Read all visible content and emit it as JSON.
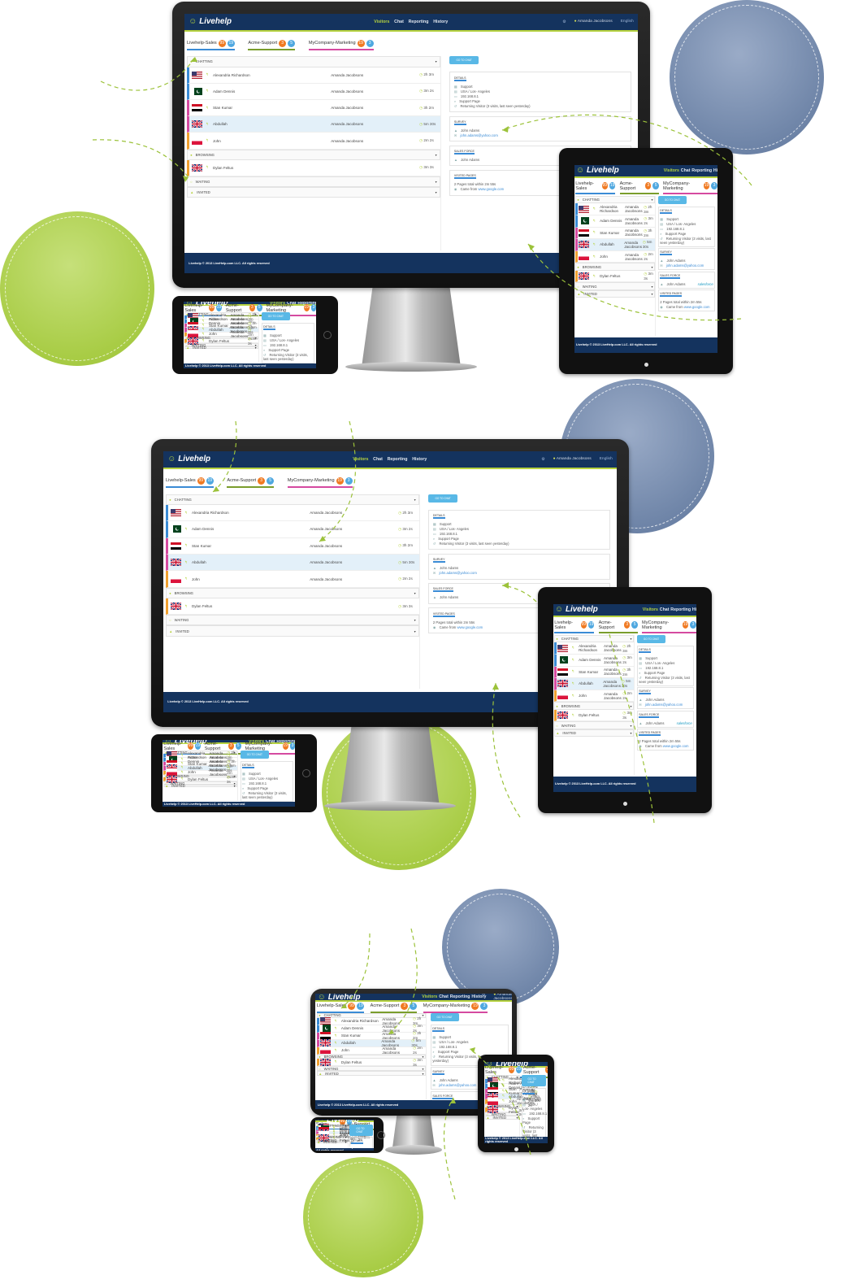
{
  "app": {
    "logo": "Livehelp",
    "nav": [
      "Visitors",
      "Chat",
      "Reporting",
      "History"
    ],
    "user": "Amanda Jacobsons",
    "language": "English",
    "footer": "Livehelp © 2013 LiveHelp.com LLC.  All rights reserved"
  },
  "tabs": [
    {
      "label": "Livehelp-Sales",
      "count_a": "99",
      "count_b": "19"
    },
    {
      "label": "Acme-Support",
      "count_a": "3",
      "count_b": "5"
    },
    {
      "label": "MyCompany-Marketing",
      "count_a": "19",
      "count_b": "3"
    }
  ],
  "sections": {
    "chatting": "CHATTING",
    "browsing": "BROWSING",
    "waiting": "WAITING",
    "invited": "INVITED"
  },
  "visitors": [
    {
      "name": "Alexandria Richardson",
      "agent": "Amanda Jacobsons",
      "time": "2h 3m",
      "flag": "us",
      "bar": "#3a8bd5"
    },
    {
      "name": "Adam Dennis",
      "agent": "Amanda Jacobsons",
      "time": "3m 2s",
      "flag": "pk",
      "bar": "#3a8bd5"
    },
    {
      "name": "Stan Kumar",
      "agent": "Amanda Jacobsons",
      "time": "3h 2m",
      "flag": "eg",
      "bar": "#d54aa0"
    },
    {
      "name": "Abdullah",
      "agent": "Amanda Jacobsons",
      "time": "5m 30s",
      "flag": "uk",
      "bar": "#d54aa0"
    },
    {
      "name": "John",
      "agent": "Amanda Jacobsons",
      "time": "2m 2s",
      "flag": "pl",
      "bar": "#f0a030"
    }
  ],
  "browsing": [
    {
      "name": "Dylan Feltus",
      "time": "3m 3s",
      "flag": "uk",
      "bar": "#f0a030"
    }
  ],
  "details": {
    "goto_chat": "GO TO CHAT",
    "details_title": "DETAILS",
    "dept": "Support",
    "location": "USA / Los- Angeles",
    "ip": "192.168.8.1",
    "page": "Support Page",
    "returning": "Returning Visitor (3 visits, last seen yesterday)",
    "survey_title": "SURVEY",
    "survey_name": "John Adams",
    "survey_email": "john.adams@yahoo.com",
    "sf_title": "SALES FORCE",
    "sf_name": "John Adams",
    "sf_logo": "salesforce",
    "visited_title": "VISITED PAGES",
    "visited_summary": "2 Pages total within 2m 55s",
    "came_from": "Came from",
    "came_from_link": "www.google.com"
  },
  "colors": {
    "header": "#14335e",
    "accent": "#b6d23f",
    "blue": "#3a8bd5",
    "circle_blue": "#7b8fb0",
    "circle_green": "#a8cc45"
  }
}
